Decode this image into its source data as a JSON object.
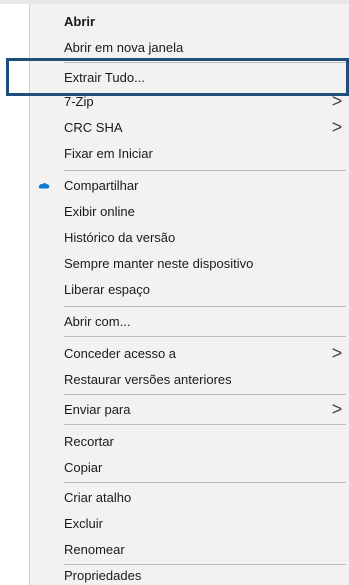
{
  "menu": {
    "items": [
      {
        "id": "abrir",
        "label": "Abrir",
        "bold": true
      },
      {
        "id": "abrir-nova-janela",
        "label": "Abrir em nova janela"
      },
      {
        "id": "extrair-tudo",
        "label": "Extrair Tudo..."
      },
      {
        "id": "7zip",
        "label": "7-Zip",
        "submenu": true
      },
      {
        "id": "crc-sha",
        "label": "CRC SHA",
        "submenu": true
      },
      {
        "id": "fixar-em-iniciar",
        "label": "Fixar em Iniciar"
      },
      {
        "id": "compartilhar",
        "label": "Compartilhar",
        "icon": "onedrive-cloud-icon"
      },
      {
        "id": "exibir-online",
        "label": "Exibir online"
      },
      {
        "id": "historico-versao",
        "label": "Histórico da versão"
      },
      {
        "id": "sempre-manter",
        "label": "Sempre manter neste dispositivo"
      },
      {
        "id": "liberar-espaco",
        "label": "Liberar espaço"
      },
      {
        "id": "abrir-com",
        "label": "Abrir com..."
      },
      {
        "id": "conceder-acesso",
        "label": "Conceder acesso a",
        "submenu": true
      },
      {
        "id": "restaurar-versoes",
        "label": "Restaurar versões anteriores"
      },
      {
        "id": "enviar-para",
        "label": "Enviar para",
        "submenu": true
      },
      {
        "id": "recortar",
        "label": "Recortar"
      },
      {
        "id": "copiar",
        "label": "Copiar"
      },
      {
        "id": "criar-atalho",
        "label": "Criar atalho"
      },
      {
        "id": "excluir",
        "label": "Excluir"
      },
      {
        "id": "renomear",
        "label": "Renomear"
      },
      {
        "id": "propriedades",
        "label": "Propriedades"
      }
    ],
    "submenu_arrow": ">",
    "highlight_color": "#1f4e79",
    "icon_color": "#0a78d4"
  }
}
